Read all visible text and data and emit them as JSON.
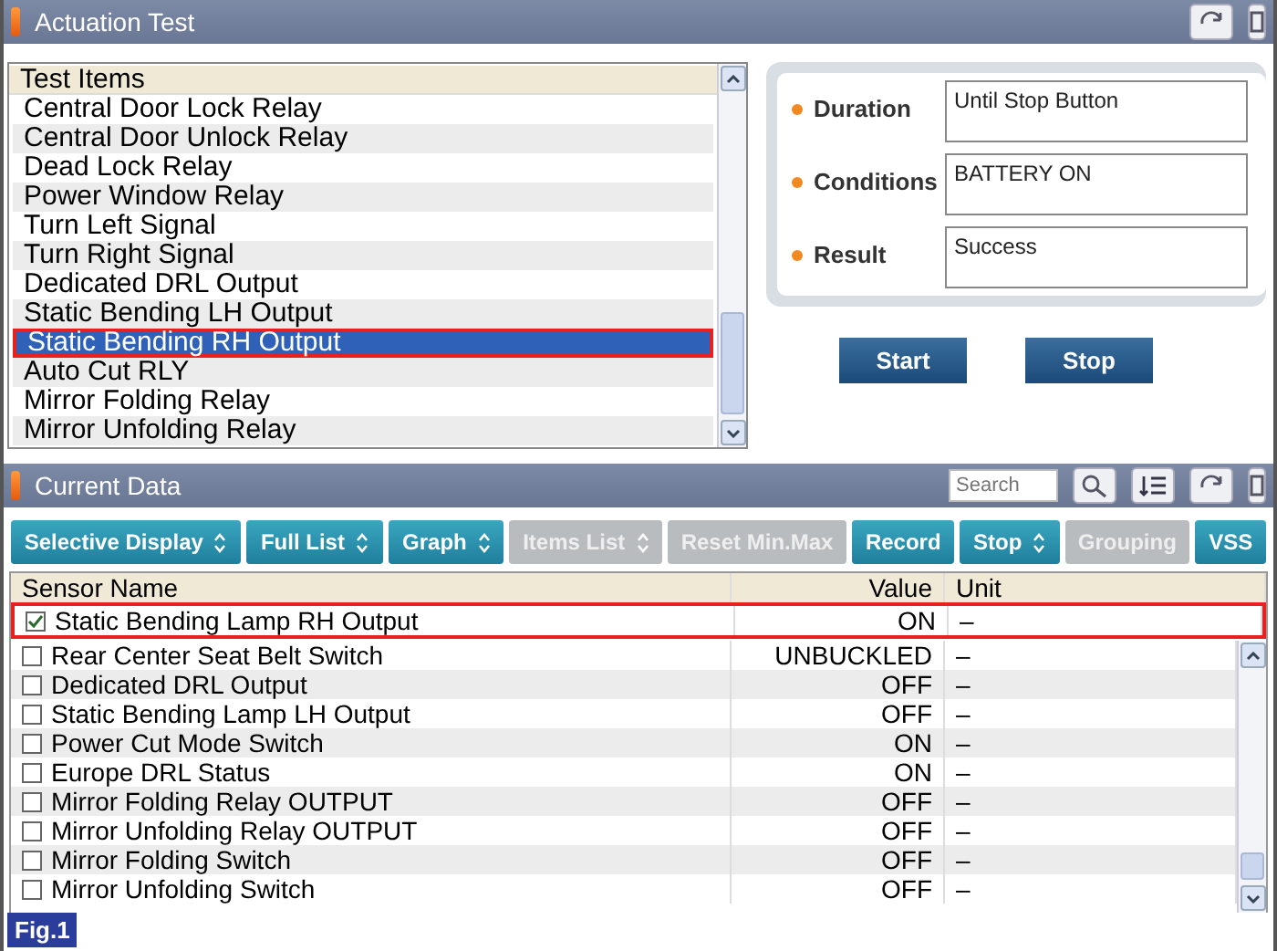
{
  "actuation": {
    "title": "Actuation Test",
    "list_header": "Test Items",
    "items": [
      {
        "label": "Central Door Lock Relay",
        "selected": false
      },
      {
        "label": "Central Door Unlock Relay",
        "selected": false
      },
      {
        "label": "Dead Lock Relay",
        "selected": false
      },
      {
        "label": "Power Window Relay",
        "selected": false
      },
      {
        "label": "Turn Left Signal",
        "selected": false
      },
      {
        "label": "Turn Right Signal",
        "selected": false
      },
      {
        "label": "Dedicated DRL Output",
        "selected": false
      },
      {
        "label": "Static Bending LH Output",
        "selected": false
      },
      {
        "label": "Static Bending RH Output",
        "selected": true
      },
      {
        "label": "Auto Cut RLY",
        "selected": false
      },
      {
        "label": "Mirror Folding Relay",
        "selected": false
      },
      {
        "label": "Mirror Unfolding Relay",
        "selected": false
      }
    ],
    "fields": [
      {
        "label": "Duration",
        "value": "Until Stop Button"
      },
      {
        "label": "Conditions",
        "value": "BATTERY ON"
      },
      {
        "label": "Result",
        "value": "Success"
      }
    ],
    "buttons": [
      "Start",
      "Stop"
    ]
  },
  "current_data": {
    "title": "Current Data",
    "search": {
      "placeholder": "Search"
    },
    "toolbar": [
      {
        "label": "Selective Display",
        "dropdown": true,
        "disabled": false
      },
      {
        "label": "Full List",
        "dropdown": true,
        "disabled": false
      },
      {
        "label": "Graph",
        "dropdown": true,
        "disabled": false
      },
      {
        "label": "Items List",
        "dropdown": true,
        "disabled": true
      },
      {
        "label": "Reset Min.Max",
        "dropdown": false,
        "disabled": true
      },
      {
        "label": "Record",
        "dropdown": false,
        "disabled": false
      },
      {
        "label": "Stop",
        "dropdown": true,
        "disabled": false
      },
      {
        "label": "Grouping",
        "dropdown": false,
        "disabled": true
      },
      {
        "label": "VSS",
        "dropdown": false,
        "disabled": false
      }
    ],
    "columns": [
      "Sensor Name",
      "Value",
      "Unit"
    ],
    "pinned_row": {
      "name": "Static Bending Lamp RH Output",
      "value": "ON",
      "unit": "–",
      "checked": true
    },
    "rows": [
      {
        "name": "Rear Center Seat Belt Switch",
        "value": "UNBUCKLED",
        "unit": "–",
        "checked": false
      },
      {
        "name": "Dedicated DRL Output",
        "value": "OFF",
        "unit": "–",
        "checked": false
      },
      {
        "name": "Static Bending Lamp LH Output",
        "value": "OFF",
        "unit": "–",
        "checked": false
      },
      {
        "name": "Power Cut Mode Switch",
        "value": "ON",
        "unit": "–",
        "checked": false
      },
      {
        "name": "Europe DRL Status",
        "value": "ON",
        "unit": "–",
        "checked": false
      },
      {
        "name": "Mirror Folding Relay OUTPUT",
        "value": "OFF",
        "unit": "–",
        "checked": false
      },
      {
        "name": "Mirror Unfolding Relay OUTPUT",
        "value": "OFF",
        "unit": "–",
        "checked": false
      },
      {
        "name": "Mirror Folding Switch",
        "value": "OFF",
        "unit": "–",
        "checked": false
      },
      {
        "name": "Mirror Unfolding Switch",
        "value": "OFF",
        "unit": "–",
        "checked": false
      }
    ]
  },
  "figure_label": "Fig.1"
}
